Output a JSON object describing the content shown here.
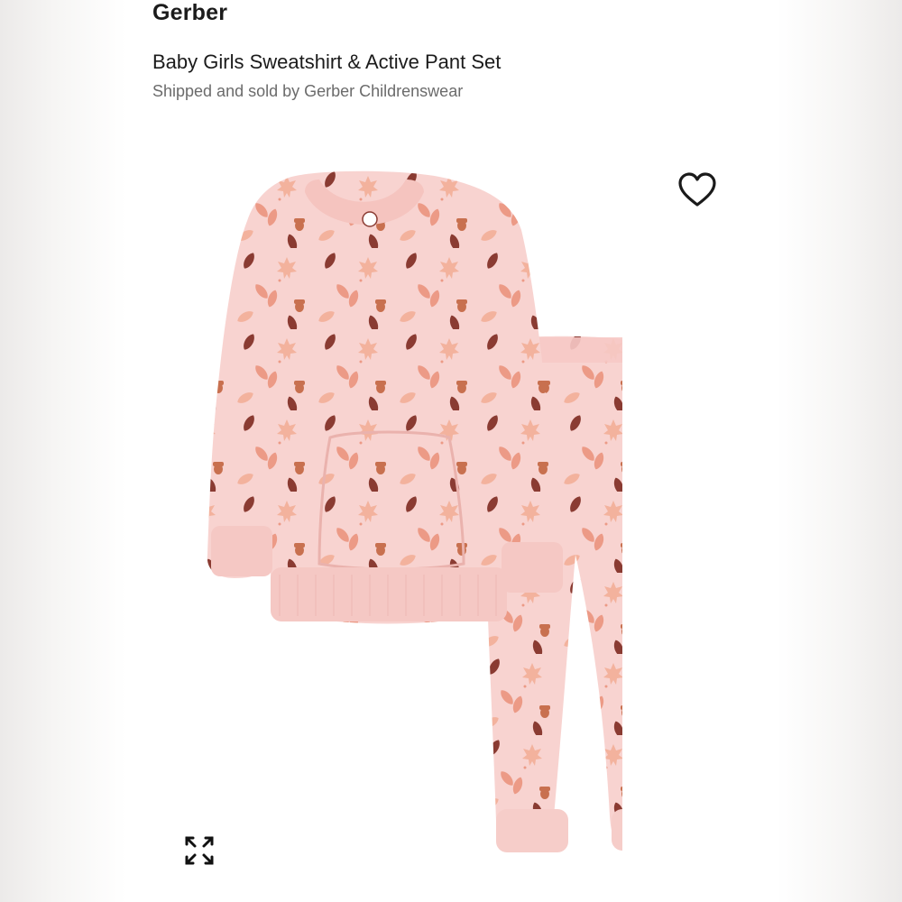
{
  "product": {
    "brand": "Gerber",
    "title": "Baby Girls Sweatshirt & Active Pant Set",
    "seller_line": "Shipped and sold by Gerber Childrenswear"
  },
  "image": {
    "subject": "pink sweatshirt and jogger pants with autumn leaf and acorn print",
    "colors": {
      "fabric": "#f8d3d0",
      "fabric_shadow": "#efbcb8",
      "leaf_coral": "#ec9a86",
      "leaf_peach": "#f3b29d",
      "leaf_brown": "#8a3b32"
    }
  },
  "controls": {
    "favorite_icon": "heart-outline-icon",
    "expand_icon": "expand-arrows-icon"
  }
}
